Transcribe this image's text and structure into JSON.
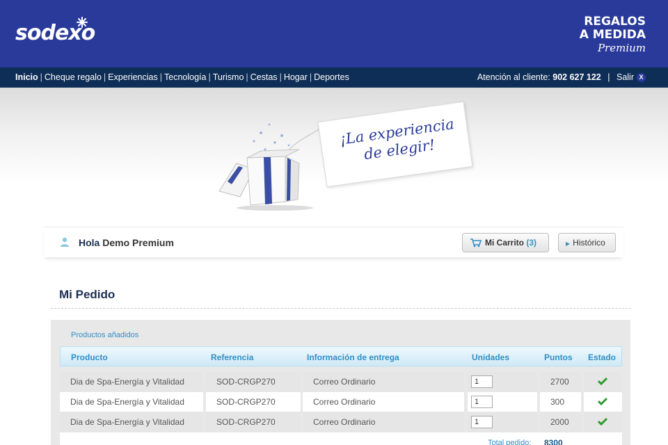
{
  "header": {
    "logo": "sodexo",
    "brand_line1": "REGALOS",
    "brand_line2": "A MEDIDA",
    "brand_line3": "Premium"
  },
  "nav": {
    "items": [
      "Inicio",
      "Cheque regalo",
      "Experiencias",
      "Tecnología",
      "Turismo",
      "Cestas",
      "Hogar",
      "Deportes"
    ],
    "support_label": "Atención al cliente:",
    "support_phone": "902 627 122",
    "logout": "Salir",
    "logout_icon": "X"
  },
  "banner": {
    "tag_line1": "¡La experiencia",
    "tag_line2": "de elegir!"
  },
  "greeting": {
    "hola": "Hola",
    "user": "Demo Premium",
    "cart_label": "Mi Carrito",
    "cart_count": "(3)",
    "history_label": "Histórico"
  },
  "order": {
    "title": "Mi Pedido",
    "subtitle": "Productos añadidos",
    "columns": [
      "Producto",
      "Referencia",
      "Información de entrega",
      "Unidades",
      "Puntos",
      "Estado"
    ],
    "rows": [
      {
        "product": "Dia de Spa-Energía y Vitalidad",
        "reference": "SOD-CRGP270",
        "delivery": "Correo Ordinario",
        "units": "1",
        "points": "2700"
      },
      {
        "product": "Dia de Spa-Energía y Vitalidad",
        "reference": "SOD-CRGP270",
        "delivery": "Correo Ordinario",
        "units": "1",
        "points": "300"
      },
      {
        "product": "Dia de Spa-Energía y Vitalidad",
        "reference": "SOD-CRGP270",
        "delivery": "Correo Ordinario",
        "units": "1",
        "points": "2000"
      }
    ],
    "total_label": "Total pedido:",
    "total_value": "8300"
  },
  "colors": {
    "header_blue": "#2a3a9b",
    "nav_navy": "#0f2e57",
    "accent_blue": "#2f8fc5",
    "check_green": "#2e9b2e"
  }
}
